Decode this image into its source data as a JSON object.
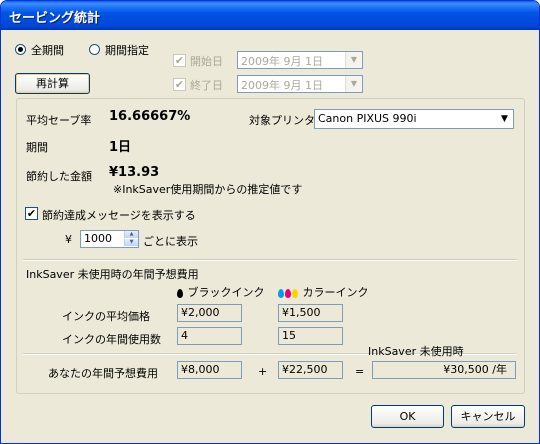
{
  "window": {
    "title": "セービング統計"
  },
  "period": {
    "radio_all": "全期間",
    "radio_specify": "期間指定",
    "start_label": "開始日",
    "start_value": "2009年  9月  1日",
    "end_label": "終了日",
    "end_value": "2009年  9月  1日",
    "recalc_button": "再計算"
  },
  "stats": {
    "save_rate_label": "平均セーブ率",
    "save_rate_value": "16.66667%",
    "printer_label": "対象プリンタ",
    "printer_value": "Canon PIXUS 990i",
    "duration_label": "期間",
    "duration_value": "1日",
    "saved_amount_label": "節約した金額",
    "saved_amount_value": "¥13.93",
    "saved_amount_note": "※InkSaver使用期間からの推定値です",
    "show_message_label": "節約達成メッセージを表示する",
    "currency_symbol": "¥",
    "interval_value": "1000",
    "interval_suffix": "ごとに表示"
  },
  "annual": {
    "section_title": "InkSaver 未使用時の年間予想費用",
    "black_ink_header": "ブラックインク",
    "color_ink_header": "カラーインク",
    "avg_price_label": "インクの平均価格",
    "avg_price_black": "¥2,000",
    "avg_price_color": "¥1,500",
    "usage_label": "インクの年間使用数",
    "usage_black": "4",
    "usage_color": "15",
    "unused_header": "InkSaver 未使用時",
    "total_label": "あなたの年間予想費用",
    "total_black": "¥8,000",
    "plus_sign": "+",
    "total_color": "¥22,500",
    "equals_sign": "=",
    "total_sum": "¥30,500 /年"
  },
  "buttons": {
    "ok": "OK",
    "cancel": "キャンセル"
  },
  "colors": {
    "titlebar": "#0055E5",
    "dialog_bg": "#ECE9D8",
    "black_drop": "#000000",
    "cyan_drop": "#00A0E9",
    "magenta_drop": "#E4007F",
    "yellow_drop": "#FFD400"
  },
  "icons": {
    "black_ink": "black-drop-icon",
    "color_ink": "color-drops-icon",
    "dropdown": "chevron-down-icon"
  }
}
